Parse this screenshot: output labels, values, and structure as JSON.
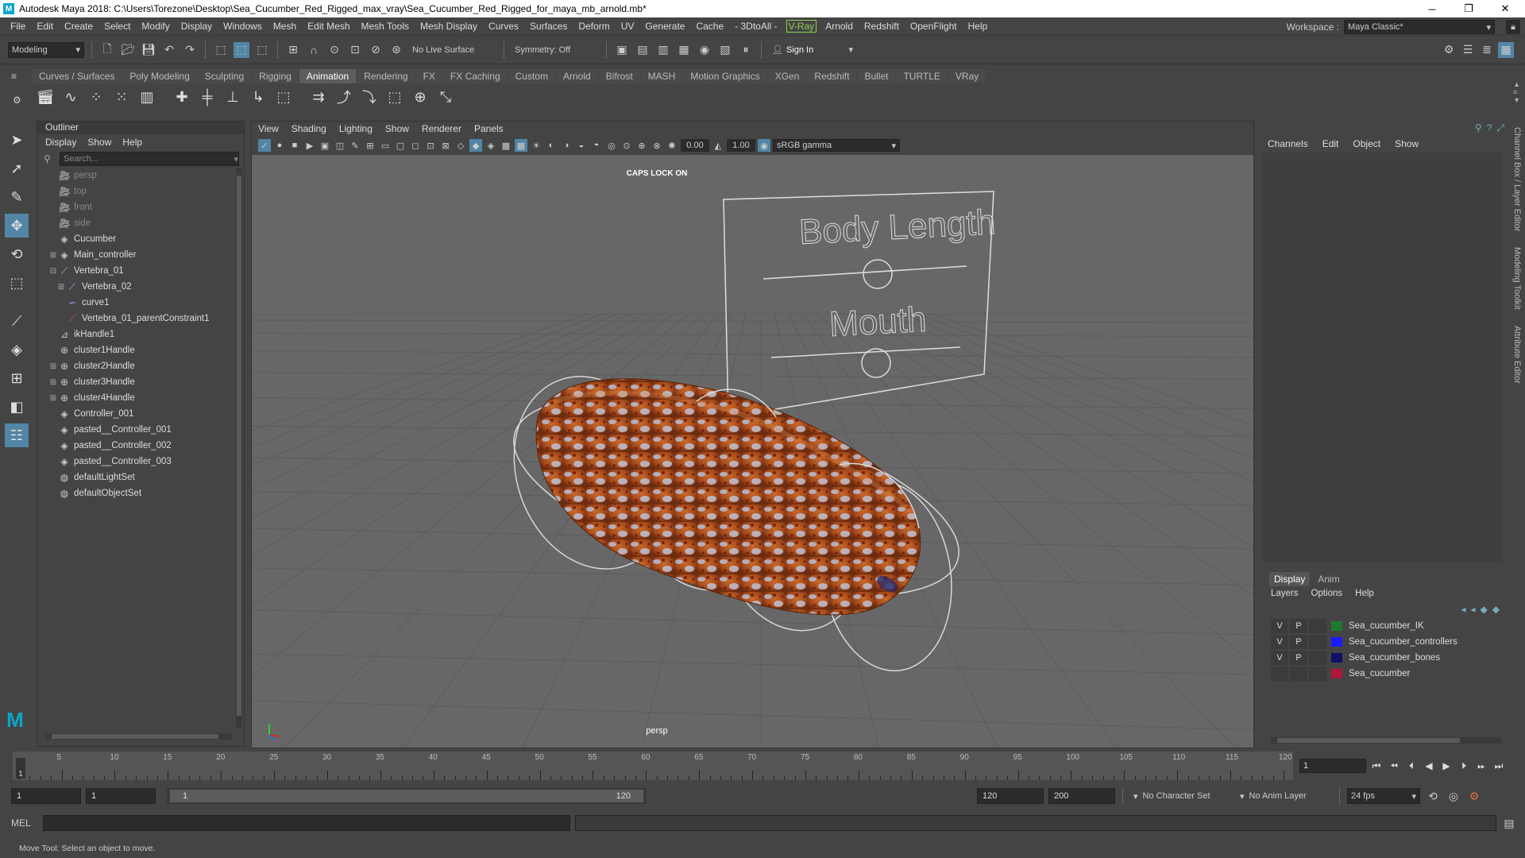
{
  "title": "Autodesk Maya 2018: C:\\Users\\Torezone\\Desktop\\Sea_Cucumber_Red_Rigged_max_vray\\Sea_Cucumber_Red_Rigged_for_maya_mb_arnold.mb*",
  "menu": [
    "File",
    "Edit",
    "Create",
    "Select",
    "Modify",
    "Display",
    "Windows",
    "Mesh",
    "Edit Mesh",
    "Mesh Tools",
    "Mesh Display",
    "Curves",
    "Surfaces",
    "Deform",
    "UV",
    "Generate",
    "Cache",
    "- 3DtoAll -"
  ],
  "menu_vray": "V-Ray",
  "menu_right": [
    "Arnold",
    "Redshift",
    "OpenFlight",
    "Help"
  ],
  "workspace": {
    "label": "Workspace :",
    "value": "Maya Classic*"
  },
  "status": {
    "mode": "Modeling",
    "live_surface": "No Live Surface",
    "symmetry": "Symmetry: Off",
    "sign_in": "Sign In"
  },
  "shelf_tabs": [
    "Curves / Surfaces",
    "Poly Modeling",
    "Sculpting",
    "Rigging",
    "Animation",
    "Rendering",
    "FX",
    "FX Caching",
    "Custom",
    "Arnold",
    "Bifrost",
    "MASH",
    "Motion Graphics",
    "XGen",
    "Redshift",
    "Bullet",
    "TURTLE",
    "VRay"
  ],
  "shelf_active": "Animation",
  "outliner": {
    "title": "Outliner",
    "menu": [
      "Display",
      "Show",
      "Help"
    ],
    "search_placeholder": "Search...",
    "items": [
      {
        "label": "persp",
        "icon": "camera-icon",
        "indent": 1,
        "dim": true,
        "expand": ""
      },
      {
        "label": "top",
        "icon": "camera-icon",
        "indent": 1,
        "dim": true,
        "expand": ""
      },
      {
        "label": "front",
        "icon": "camera-icon",
        "indent": 1,
        "dim": true,
        "expand": ""
      },
      {
        "label": "side",
        "icon": "camera-icon",
        "indent": 1,
        "dim": true,
        "expand": ""
      },
      {
        "label": "Cucumber",
        "icon": "mesh-icon",
        "indent": 1,
        "dim": false,
        "expand": ""
      },
      {
        "label": "Main_controller",
        "icon": "mesh-icon",
        "indent": 1,
        "dim": false,
        "expand": "+"
      },
      {
        "label": "Vertebra_01",
        "icon": "joint-icon",
        "indent": 1,
        "dim": false,
        "expand": "−"
      },
      {
        "label": "Vertebra_02",
        "icon": "joint-icon",
        "indent": 2,
        "dim": false,
        "expand": "+"
      },
      {
        "label": "curve1",
        "icon": "curve-icon",
        "indent": 2,
        "dim": false,
        "expand": ""
      },
      {
        "label": "Vertebra_01_parentConstraint1",
        "icon": "constraint-icon",
        "indent": 2,
        "dim": false,
        "expand": ""
      },
      {
        "label": "ikHandle1",
        "icon": "ik-handle-icon",
        "indent": 1,
        "dim": false,
        "expand": ""
      },
      {
        "label": "cluster1Handle",
        "icon": "cluster-icon",
        "indent": 1,
        "dim": false,
        "expand": ""
      },
      {
        "label": "cluster2Handle",
        "icon": "cluster-icon",
        "indent": 1,
        "dim": false,
        "expand": "+"
      },
      {
        "label": "cluster3Handle",
        "icon": "cluster-icon",
        "indent": 1,
        "dim": false,
        "expand": "+"
      },
      {
        "label": "cluster4Handle",
        "icon": "cluster-icon",
        "indent": 1,
        "dim": false,
        "expand": "+"
      },
      {
        "label": "Controller_001",
        "icon": "mesh-icon",
        "indent": 1,
        "dim": false,
        "expand": ""
      },
      {
        "label": "pasted__Controller_001",
        "icon": "mesh-icon",
        "indent": 1,
        "dim": false,
        "expand": ""
      },
      {
        "label": "pasted__Controller_002",
        "icon": "mesh-icon",
        "indent": 1,
        "dim": false,
        "expand": ""
      },
      {
        "label": "pasted__Controller_003",
        "icon": "mesh-icon",
        "indent": 1,
        "dim": false,
        "expand": ""
      },
      {
        "label": "defaultLightSet",
        "icon": "set-icon",
        "indent": 1,
        "dim": false,
        "expand": ""
      },
      {
        "label": "defaultObjectSet",
        "icon": "set-icon",
        "indent": 1,
        "dim": false,
        "expand": ""
      }
    ]
  },
  "viewport": {
    "menu": [
      "View",
      "Shading",
      "Lighting",
      "Show",
      "Renderer",
      "Panels"
    ],
    "exposure": "0.00",
    "gamma": "1.00",
    "color_space": "sRGB gamma",
    "caps_lock": "CAPS LOCK ON",
    "camera": "persp",
    "board_label_1": "Body Length",
    "board_label_2": "Mouth"
  },
  "channel_box": {
    "menu": [
      "Channels",
      "Edit",
      "Object",
      "Show"
    ]
  },
  "layer_editor": {
    "tabs": [
      "Display",
      "Anim"
    ],
    "menu": [
      "Layers",
      "Options",
      "Help"
    ],
    "layers": [
      {
        "v": "V",
        "p": "P",
        "name": "Sea_cucumber_IK",
        "color": "#1f7a2e"
      },
      {
        "v": "V",
        "p": "P",
        "name": "Sea_cucumber_controllers",
        "color": "#1a1aff"
      },
      {
        "v": "V",
        "p": "P",
        "name": "Sea_cucumber_bones",
        "color": "#10106a"
      },
      {
        "v": "",
        "p": "",
        "name": "Sea_cucumber",
        "color": "#b0173a"
      }
    ]
  },
  "side_tabs": [
    "Channel Box / Layer Editor",
    "Modeling Toolkit",
    "Attribute Editor"
  ],
  "timeline": {
    "ticks": [
      "5",
      "10",
      "15",
      "20",
      "25",
      "30",
      "35",
      "40",
      "45",
      "50",
      "55",
      "60",
      "65",
      "70",
      "75",
      "80",
      "85",
      "90",
      "95",
      "100",
      "105",
      "110",
      "115",
      "120"
    ],
    "current_marker": "1",
    "current_frame": "1"
  },
  "range": {
    "start": "1",
    "playback_start": "1",
    "slider_start": "1",
    "slider_end": "120",
    "playback_end": "120",
    "end": "200",
    "character_set": "No Character Set",
    "anim_layer": "No Anim Layer",
    "fps": "24 fps"
  },
  "command": {
    "label": "MEL"
  },
  "help_line": "Move Tool: Select an object to move."
}
